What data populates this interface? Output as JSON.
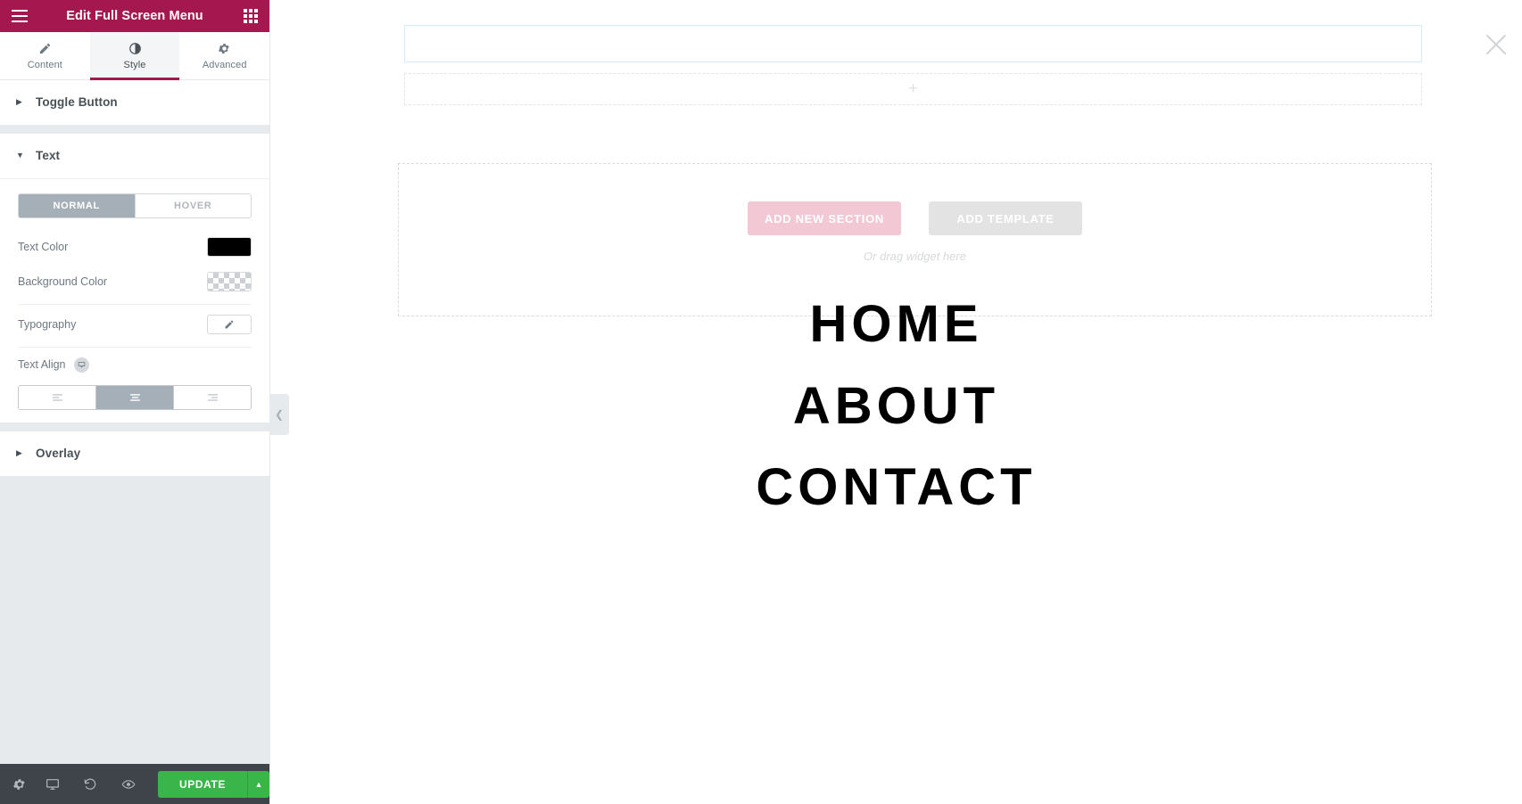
{
  "panel": {
    "header": {
      "title": "Edit Full Screen Menu",
      "menu_icon": "hamburger-icon",
      "widgets_icon": "grid-icon"
    },
    "tabs": [
      {
        "label": "Content",
        "icon": "pencil-icon",
        "active": false
      },
      {
        "label": "Style",
        "icon": "contrast-icon",
        "active": true
      },
      {
        "label": "Advanced",
        "icon": "gear-icon",
        "active": false
      }
    ],
    "sections": [
      {
        "title": "Toggle Button",
        "expanded": false
      },
      {
        "title": "Text",
        "expanded": true
      },
      {
        "title": "Overlay",
        "expanded": false
      }
    ],
    "text_section": {
      "state_tabs": [
        {
          "label": "NORMAL",
          "active": true
        },
        {
          "label": "HOVER",
          "active": false
        }
      ],
      "controls": {
        "text_color_label": "Text Color",
        "text_color_value": "#000000",
        "background_color_label": "Background Color",
        "background_color_value": "transparent",
        "typography_label": "Typography",
        "typography_icon": "pencil-icon",
        "text_align_label": "Text Align",
        "text_align_responsive_icon": "device-icon",
        "text_align_options": [
          {
            "name": "left",
            "icon": "align-left-icon",
            "selected": false
          },
          {
            "name": "center",
            "icon": "align-center-icon",
            "selected": true
          },
          {
            "name": "right",
            "icon": "align-right-icon",
            "selected": false
          }
        ]
      }
    },
    "collapse_handle_icon": "chevron-left-icon",
    "footer": {
      "icons": [
        {
          "name": "settings-icon"
        },
        {
          "name": "responsive-mode-icon"
        },
        {
          "name": "history-icon"
        },
        {
          "name": "preview-icon"
        }
      ],
      "update_label": "UPDATE",
      "update_caret_icon": "chevron-up-icon",
      "update_color": "#39b54a"
    }
  },
  "canvas": {
    "selected_section_close_icon": "close-icon",
    "add_section_inline_icon": "plus-icon",
    "drop_zone": {
      "add_new_section_label": "ADD NEW SECTION",
      "add_template_label": "ADD TEMPLATE",
      "drag_hint": "Or drag widget here",
      "add_new_section_color": "#f2c8d5",
      "add_template_color": "#e3e3e3"
    },
    "menu_items": [
      {
        "label": "HOME"
      },
      {
        "label": "ABOUT"
      },
      {
        "label": "CONTACT"
      }
    ]
  }
}
